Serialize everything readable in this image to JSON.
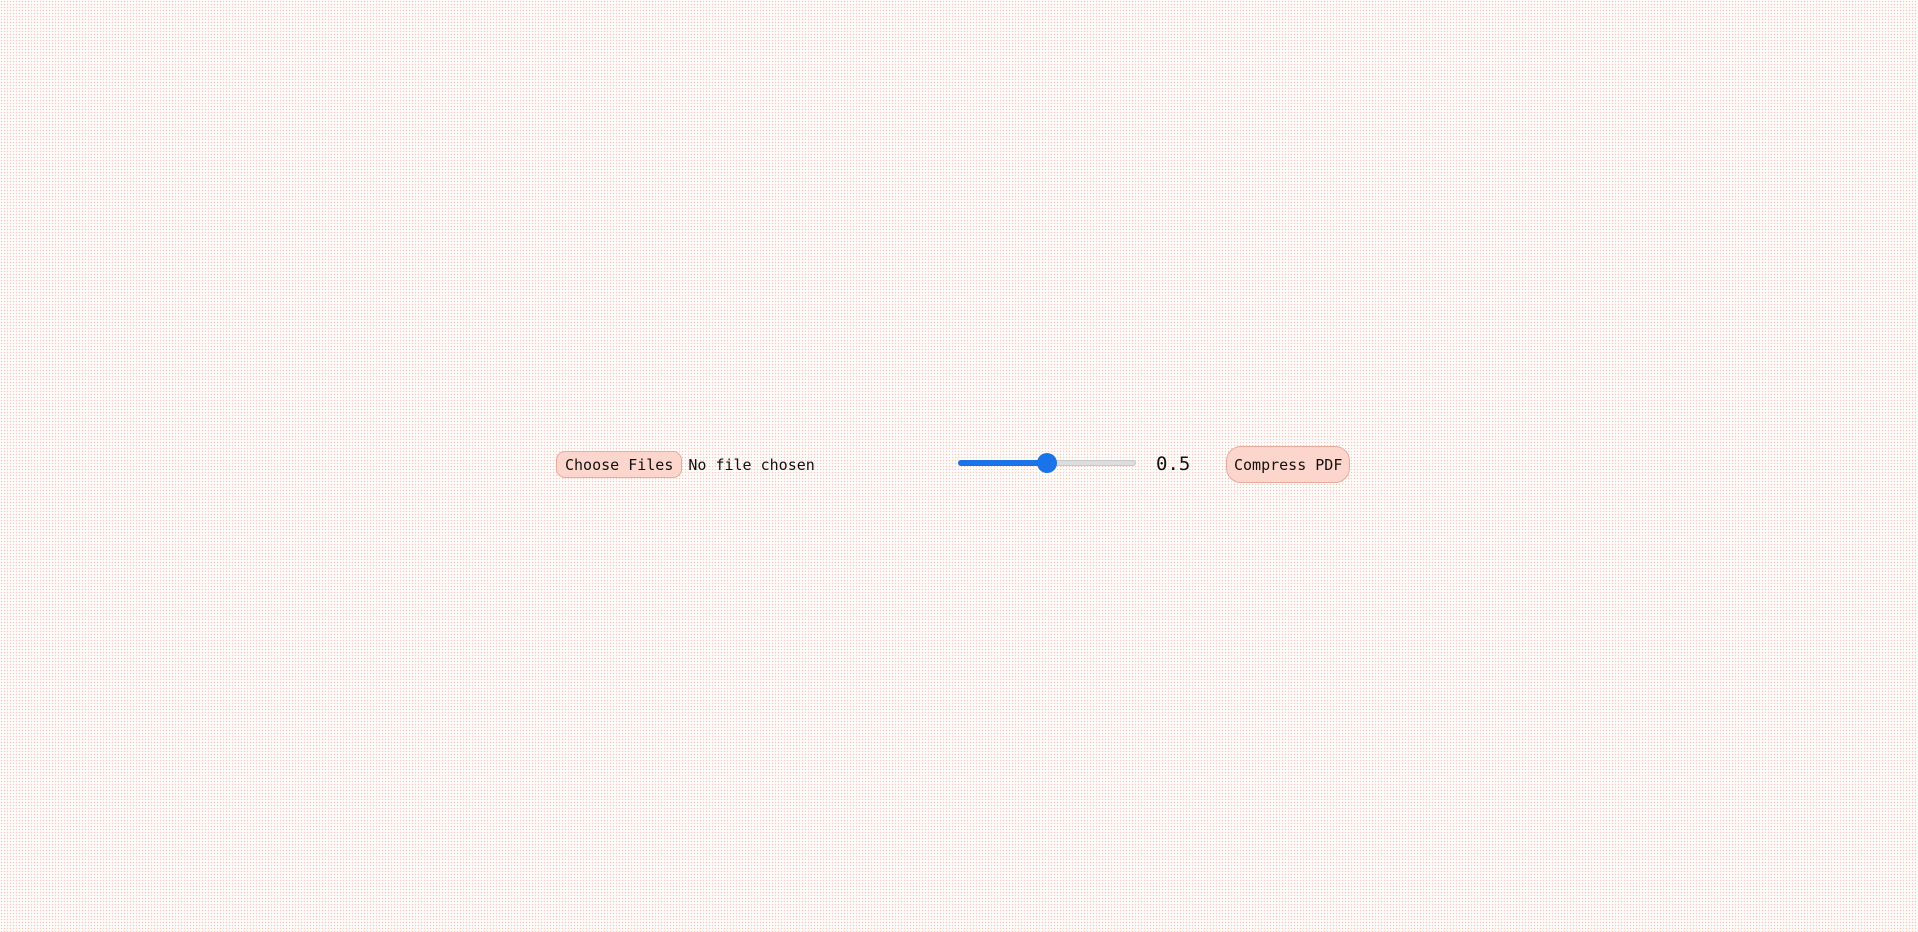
{
  "file_input": {
    "button_label": "Choose Files",
    "status_text": "No file chosen"
  },
  "quality_slider": {
    "min": 0,
    "max": 1,
    "value": 0.5,
    "display_value": "0.5"
  },
  "compress_button": {
    "label": "Compress PDF"
  },
  "colors": {
    "accent": "#1a73e8",
    "button_bg": "#fcd6cc",
    "button_border": "#e9aa9b",
    "page_dots": "#f6c9bf"
  }
}
